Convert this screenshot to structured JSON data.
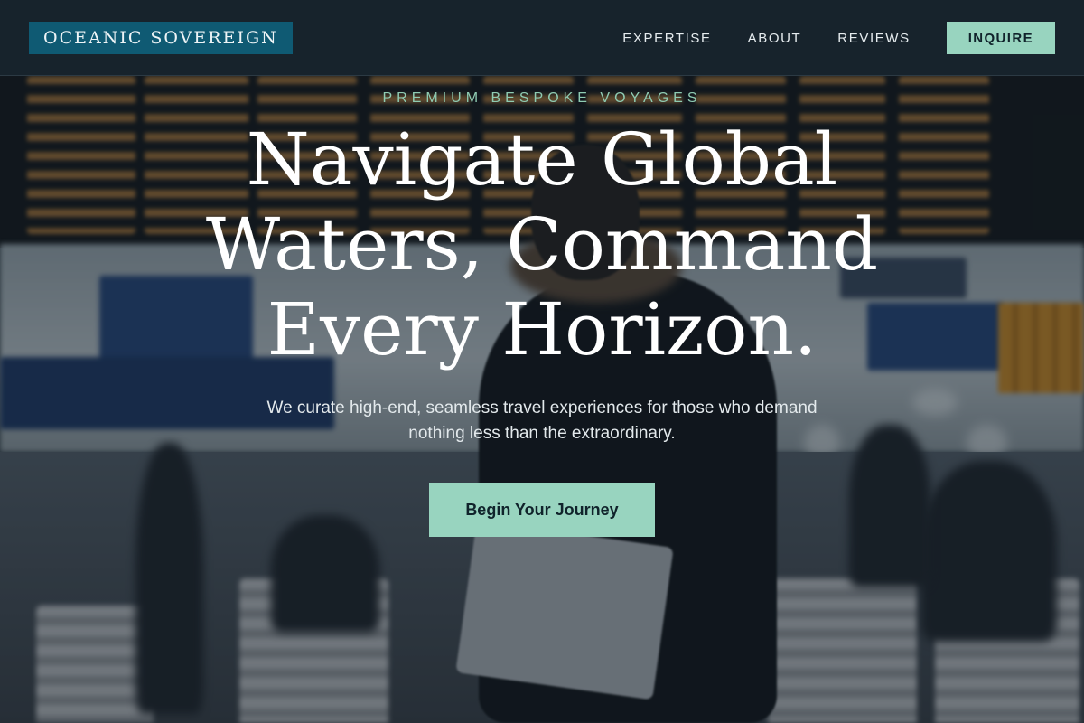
{
  "header": {
    "brand": "OCEANIC SOVEREIGN",
    "nav": [
      {
        "label": "EXPERTISE"
      },
      {
        "label": "ABOUT"
      },
      {
        "label": "REVIEWS"
      }
    ],
    "cta_label": "INQUIRE"
  },
  "hero": {
    "eyebrow": "PREMIUM BESPOKE VOYAGES",
    "headline": "Navigate Global Waters, Command Every Horizon.",
    "subtext": "We curate high-end, seamless travel experiences for those who demand nothing less than the extraordinary.",
    "cta_label": "Begin Your Journey"
  },
  "colors": {
    "header_bg": "#17232c",
    "brand_bg": "#0f5a73",
    "accent": "#98d4bf",
    "eyebrow": "#8fcbb2"
  }
}
